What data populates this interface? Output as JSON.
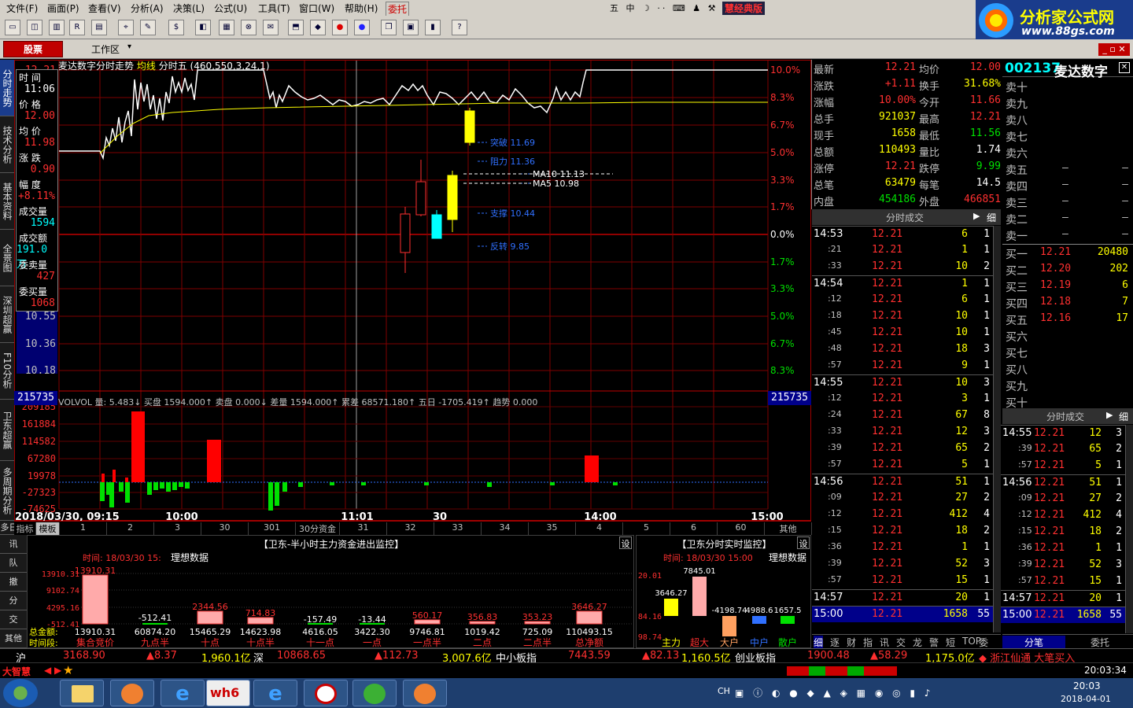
{
  "menu": [
    "文件(F)",
    "画面(P)",
    "查看(V)",
    "分析(A)",
    "决策(L)",
    "公式(U)",
    "工具(T)",
    "窗口(W)",
    "帮助(H)",
    "委托"
  ],
  "edition": "慧经典版",
  "logo": {
    "title": "分析家公式网",
    "url": "www.88gs.com"
  },
  "tabs": {
    "stocks": "股票",
    "workspace": "工作区"
  },
  "side_tabs": [
    "分时走势",
    "技术分析",
    "基本资料",
    "全景图",
    "深圳超赢",
    "F10分析",
    "卫东超赢",
    "多周期分析"
  ],
  "side_tabs2": [
    "多日统计",
    "讯",
    "队",
    "撤",
    "分",
    "交",
    "其他"
  ],
  "chart_header": {
    "title": "麦达数字分时走势",
    "line": "均线",
    "indicator": "分时五",
    "params": "(460,550,3,24,1)"
  },
  "cursor_info": [
    {
      "label": "时  间",
      "value": "11:06"
    },
    {
      "label": "价  格",
      "value": "12.00"
    },
    {
      "label": "均  价",
      "value": "11.98"
    },
    {
      "label": "涨  跌",
      "value": "0.90"
    },
    {
      "label": "幅  度",
      "value": "+8.11%"
    },
    {
      "label": "成交量",
      "value": "1594"
    },
    {
      "label": "成交额",
      "value": "191.0万"
    },
    {
      "label": "委卖量",
      "value": "427"
    },
    {
      "label": "委买量",
      "value": "1068"
    }
  ],
  "price_axis_left": [
    "12.21",
    "10.55",
    "10.36",
    "10.18"
  ],
  "pct_axis_right": [
    "10.0%",
    "8.3%",
    "6.7%",
    "5.0%",
    "3.3%",
    "1.7%",
    "0.0%",
    "1.7%",
    "3.3%",
    "5.0%",
    "6.7%",
    "8.3%"
  ],
  "annotations": [
    {
      "text": "突破 11.69"
    },
    {
      "text": "阻力 11.36"
    },
    {
      "text": "MA10 11.13"
    },
    {
      "text": "MA5 10.98"
    },
    {
      "text": "支撑 10.44"
    },
    {
      "text": "反转 9.85"
    }
  ],
  "vol_label": "215735",
  "vol_header": "VOLVOL 量: 5.483↓ 买盘 1594.000↑ 卖盘 0.000↓ 差量 1594.000↑ 累差 68571.180↑ 五日 -1705.419↑ 趋势 0.000",
  "vol_axis": [
    "209185",
    "161884",
    "114582",
    "67280",
    "19978",
    "-27323",
    "-74625"
  ],
  "time_axis": [
    "2018/03/30, 09:15",
    "10:00",
    "11:01",
    "30",
    "14:00",
    "15:00"
  ],
  "bottom_tabs": [
    "指标",
    "模板",
    "1",
    "2",
    "3",
    "30",
    "301",
    "30分资金",
    "31",
    "32",
    "33",
    "34",
    "35",
    "4",
    "5",
    "6",
    "60",
    "其他"
  ],
  "panel_left": {
    "title": "【卫东-半小时主力资金进出监控】",
    "set": "设",
    "time_label": "时间: 18/03/30 15:",
    "ideal": "理想数据",
    "axis": [
      "13910.31",
      "9102.74",
      "4295.16",
      "-512.41"
    ],
    "bar_labels": [
      "13910.31",
      "-512.41",
      "2344.56",
      "714.83",
      "-157.49",
      "-13.44",
      "560.17",
      "356.83",
      "353.23",
      "3646.27"
    ],
    "total_label": "总金额:",
    "totals": [
      "13910.31",
      "60874.20",
      "15465.29",
      "14623.98",
      "4616.05",
      "3422.30",
      "9746.81",
      "1019.42",
      "725.09",
      "110493.15"
    ],
    "period_label": "时间段:",
    "periods": [
      "集合竞价",
      "九点半",
      "十点",
      "十点半",
      "十一点",
      "一点",
      "一点半",
      "二点",
      "二点半",
      "总净额"
    ]
  },
  "panel_right": {
    "title": "【卫东分时实时监控】",
    "set": "设",
    "time_label": "时间: 18/03/30 15:00",
    "ideal": "理想数据",
    "axis": [
      "20.01",
      "84.16",
      "98.74"
    ],
    "vals": [
      "3646.27",
      "7845.01",
      "-4198.74",
      "4988.6",
      "1657.5"
    ],
    "cats": [
      "主力",
      "超大",
      "大户",
      "中户",
      "散户"
    ]
  },
  "quote": {
    "rows": [
      {
        "l1": "最新",
        "v1": "12.21",
        "l2": "均价",
        "v2": "12.00"
      },
      {
        "l1": "涨跌",
        "v1": "+1.11",
        "l2": "换手",
        "v2": "31.68%"
      },
      {
        "l1": "涨幅",
        "v1": "10.00%",
        "l2": "今开",
        "v2": "11.66"
      },
      {
        "l1": "总手",
        "v1": "921037",
        "l2": "最高",
        "v2": "12.21"
      },
      {
        "l1": "现手",
        "v1": "1658",
        "l2": "最低",
        "v2": "11.56"
      },
      {
        "l1": "总额",
        "v1": "110493",
        "l2": "量比",
        "v2": "1.74"
      },
      {
        "l1": "涨停",
        "v1": "12.21",
        "l2": "跌停",
        "v2": "9.99"
      },
      {
        "l1": "总笔",
        "v1": "63479",
        "l2": "每笔",
        "v2": "14.5"
      },
      {
        "l1": "内盘",
        "v1": "454186",
        "l2": "外盘",
        "v2": "466851"
      }
    ]
  },
  "ticks_title": "分时成交",
  "ticks_detail": "细",
  "ticks": [
    [
      "14:53",
      "12.21",
      "6",
      "1"
    ],
    [
      ":21",
      "12.21",
      "1",
      "1"
    ],
    [
      ":33",
      "12.21",
      "10",
      "2"
    ],
    [
      "14:54",
      "12.21",
      "1",
      "1"
    ],
    [
      ":12",
      "12.21",
      "6",
      "1"
    ],
    [
      ":18",
      "12.21",
      "10",
      "1"
    ],
    [
      ":45",
      "12.21",
      "10",
      "1"
    ],
    [
      ":48",
      "12.21",
      "18",
      "3"
    ],
    [
      ":57",
      "12.21",
      "9",
      "1"
    ],
    [
      "14:55",
      "12.21",
      "10",
      "3"
    ],
    [
      ":12",
      "12.21",
      "3",
      "1"
    ],
    [
      ":24",
      "12.21",
      "67",
      "8"
    ],
    [
      ":33",
      "12.21",
      "12",
      "3"
    ],
    [
      ":39",
      "12.21",
      "65",
      "2"
    ],
    [
      ":57",
      "12.21",
      "5",
      "1"
    ],
    [
      "14:56",
      "12.21",
      "51",
      "1"
    ],
    [
      ":09",
      "12.21",
      "27",
      "2"
    ],
    [
      ":12",
      "12.21",
      "412",
      "4"
    ],
    [
      ":15",
      "12.21",
      "18",
      "2"
    ],
    [
      ":36",
      "12.21",
      "1",
      "1"
    ],
    [
      ":39",
      "12.21",
      "52",
      "3"
    ],
    [
      ":57",
      "12.21",
      "15",
      "1"
    ],
    [
      "14:57",
      "12.21",
      "20",
      "1"
    ],
    [
      "15:00",
      "12.21",
      "1658",
      "55"
    ]
  ],
  "ticks_footer": [
    "细",
    "逐",
    "财",
    "指",
    "讯",
    "交",
    "龙",
    "警",
    "短",
    "TOP",
    "委"
  ],
  "stock": {
    "code": "002137",
    "name": "麦达数字"
  },
  "book_sells": [
    [
      "卖十",
      "",
      ""
    ],
    [
      "卖九",
      "",
      ""
    ],
    [
      "卖八",
      "",
      ""
    ],
    [
      "卖七",
      "",
      ""
    ],
    [
      "卖六",
      "",
      ""
    ],
    [
      "卖五",
      "–",
      "–"
    ],
    [
      "卖四",
      "–",
      "–"
    ],
    [
      "卖三",
      "–",
      "–"
    ],
    [
      "卖二",
      "–",
      "–"
    ],
    [
      "卖一",
      "–",
      "–"
    ]
  ],
  "book_buys": [
    [
      "买一",
      "12.21",
      "20480"
    ],
    [
      "买二",
      "12.20",
      "202"
    ],
    [
      "买三",
      "12.19",
      "6"
    ],
    [
      "买四",
      "12.18",
      "7"
    ],
    [
      "买五",
      "12.16",
      "17"
    ],
    [
      "买六",
      "",
      ""
    ],
    [
      "买七",
      "",
      ""
    ],
    [
      "买八",
      "",
      ""
    ],
    [
      "买九",
      "",
      ""
    ],
    [
      "买十",
      "",
      ""
    ]
  ],
  "ticks2_title": "分时成交",
  "ticks2_detail": "细",
  "ticks2": [
    [
      "14:55",
      "12.21",
      "12",
      "3"
    ],
    [
      ":39",
      "12.21",
      "65",
      "2"
    ],
    [
      ":57",
      "12.21",
      "5",
      "1"
    ],
    [
      "14:56",
      "12.21",
      "51",
      "1"
    ],
    [
      ":09",
      "12.21",
      "27",
      "2"
    ],
    [
      ":12",
      "12.21",
      "412",
      "4"
    ],
    [
      ":15",
      "12.21",
      "18",
      "2"
    ],
    [
      ":36",
      "12.21",
      "1",
      "1"
    ],
    [
      ":39",
      "12.21",
      "52",
      "3"
    ],
    [
      ":57",
      "12.21",
      "15",
      "1"
    ],
    [
      "14:57",
      "12.21",
      "20",
      "1"
    ],
    [
      "15:00",
      "12.21",
      "1658",
      "55"
    ]
  ],
  "ticks2_footer": [
    "分笔",
    "委托"
  ],
  "status": {
    "sh": "沪",
    "sh_idx": "3168.90",
    "sh_chg": "▲8.37",
    "sh_amt": "1,960.1亿",
    "sz": "深",
    "sz_idx": "10868.65",
    "sz_chg": "▲112.73",
    "sz_amt": "3,007.6亿",
    "zx": "中小板指",
    "zx_idx": "7443.59",
    "zx_chg": "▲82.13",
    "zx_amt": "1,160.5亿",
    "cy": "创业板指",
    "cy_idx": "1900.48",
    "cy_chg": "▲58.29",
    "cy_amt": "1,175.0亿",
    "news": "◆ 浙江仙通 大笔买入",
    "brand": "大智慧",
    "clock": "20:03:34"
  },
  "taskbar": {
    "time": "20:03",
    "date": "2018-04-01",
    "lang": "CH"
  }
}
